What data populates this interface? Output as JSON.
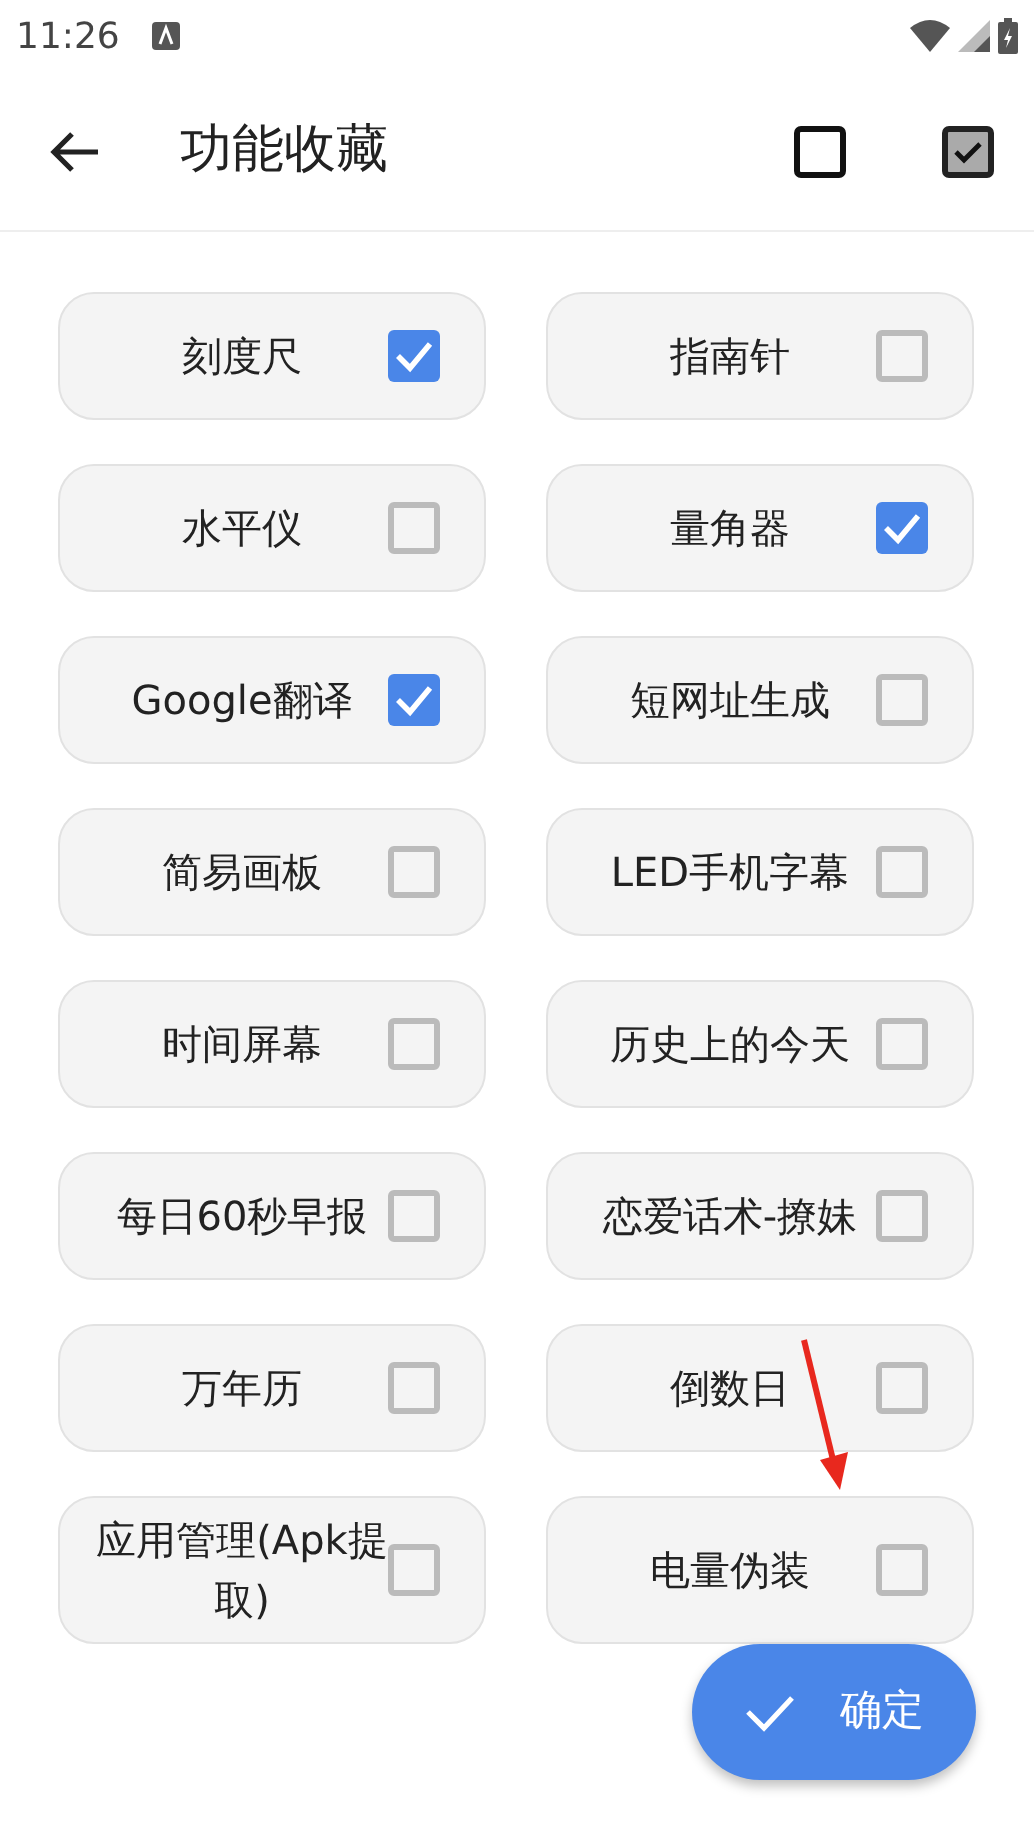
{
  "status_bar": {
    "time": "11:26"
  },
  "app_bar": {
    "title": "功能收藏"
  },
  "items": [
    {
      "label": "刻度尺",
      "checked": true
    },
    {
      "label": "指南针",
      "checked": false
    },
    {
      "label": "水平仪",
      "checked": false
    },
    {
      "label": "量角器",
      "checked": true
    },
    {
      "label": "Google翻译",
      "checked": true
    },
    {
      "label": "短网址生成",
      "checked": false
    },
    {
      "label": "简易画板",
      "checked": false
    },
    {
      "label": "LED手机字幕",
      "checked": false
    },
    {
      "label": "时间屏幕",
      "checked": false
    },
    {
      "label": "历史上的今天",
      "checked": false
    },
    {
      "label": "每日60秒早报",
      "checked": false
    },
    {
      "label": "恋爱话术-撩妹",
      "checked": false
    },
    {
      "label": "万年历",
      "checked": false
    },
    {
      "label": "倒数日",
      "checked": false
    },
    {
      "label": "应用管理(Apk提取)",
      "checked": false
    },
    {
      "label": "电量伪装",
      "checked": false
    }
  ],
  "fab": {
    "label": "确定"
  }
}
